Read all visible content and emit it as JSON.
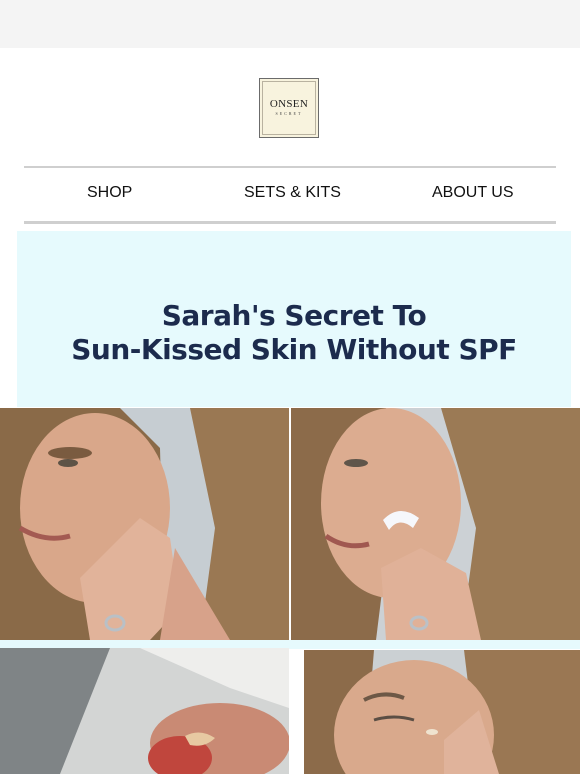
{
  "brand": {
    "logo_word": "ONSEN",
    "logo_sub": "SECRET"
  },
  "nav": {
    "items": [
      {
        "label": "SHOP"
      },
      {
        "label": "SETS & KITS"
      },
      {
        "label": "ABOUT US"
      }
    ]
  },
  "hero": {
    "title_line1": "Sarah's Secret To",
    "title_line2": "Sun-Kissed Skin Without SPF"
  },
  "images": [
    {
      "icon": "photo-woman-touching-face"
    },
    {
      "icon": "photo-woman-applying-cream"
    },
    {
      "icon": "photo-hand-with-product"
    },
    {
      "icon": "photo-woman-blending-cream"
    }
  ],
  "colors": {
    "hero_bg": "#e6fafd",
    "title": "#1c2b4d",
    "rule": "#cfcfcf",
    "logo_bg": "#f8f3de"
  }
}
